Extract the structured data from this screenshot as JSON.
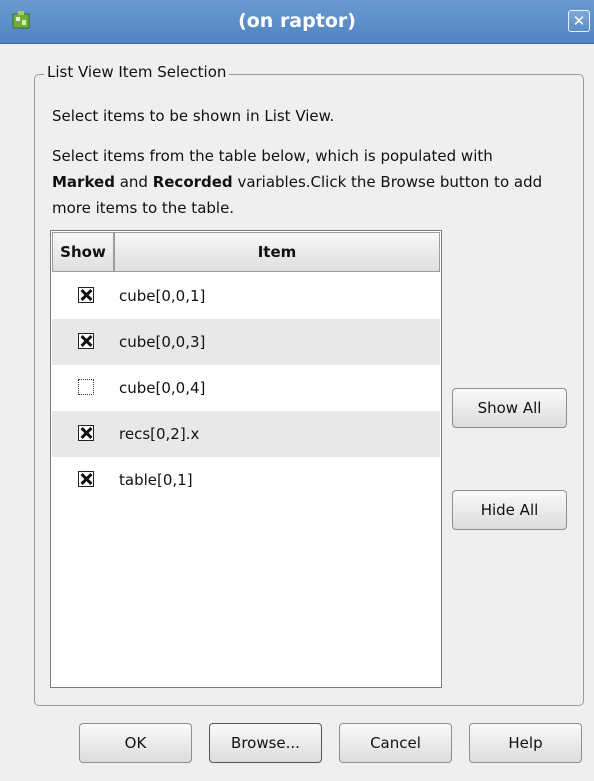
{
  "window": {
    "title": "(on raptor)",
    "close_label": "✕"
  },
  "group": {
    "title": "List View Item Selection",
    "description1": "Select items to be shown in List View.",
    "description2_part1": "Select items from the table below, which is populated with ",
    "description2_bold1": "Marked",
    "description2_part2": " and ",
    "description2_bold2": "Recorded",
    "description2_part3": " variables.Click the Browse button to add more items to the table."
  },
  "table": {
    "columns": [
      "Show",
      "Item"
    ],
    "rows": [
      {
        "checked": true,
        "item": "cube[0,0,1]"
      },
      {
        "checked": true,
        "item": "cube[0,0,3]"
      },
      {
        "checked": false,
        "item": "cube[0,0,4]"
      },
      {
        "checked": true,
        "item": "recs[0,2].x"
      },
      {
        "checked": true,
        "item": "table[0,1]"
      }
    ]
  },
  "side_buttons": {
    "show_all": "Show All",
    "hide_all": "Hide All"
  },
  "footer_buttons": {
    "ok": "OK",
    "browse": "Browse...",
    "cancel": "Cancel",
    "help": "Help"
  },
  "colors": {
    "titlebar": "#5a8cc8",
    "background": "#efefef",
    "row_alt": "#e8e8e8"
  }
}
